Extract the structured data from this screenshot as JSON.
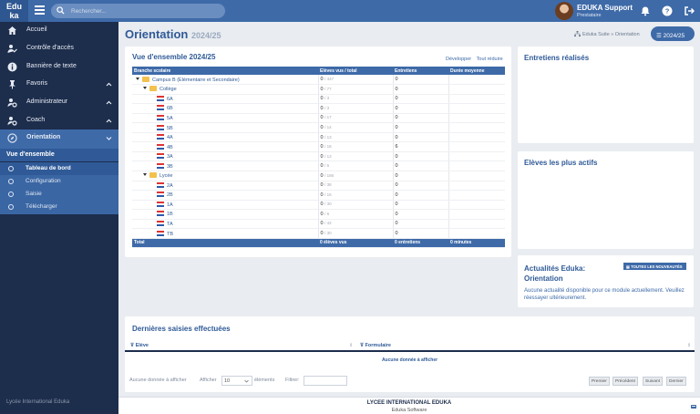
{
  "app": {
    "logo_line1": "Edu",
    "logo_line2": "ka"
  },
  "search": {
    "placeholder": "Rechercher..."
  },
  "user": {
    "name": "EDUKA Support",
    "role": "Prestataire"
  },
  "sidebar": {
    "items": [
      {
        "label": "Accueil",
        "icon": "home-icon"
      },
      {
        "label": "Contrôle d'accès",
        "icon": "user-check-icon"
      },
      {
        "label": "Bannière de texte",
        "icon": "info-icon"
      },
      {
        "label": "Favoris",
        "icon": "pin-icon"
      },
      {
        "label": "Administrateur",
        "icon": "user-gear-icon"
      },
      {
        "label": "Coach",
        "icon": "user-gear-icon"
      },
      {
        "label": "Orientation",
        "icon": "compass-icon"
      }
    ],
    "sub_header": "Vue d'ensemble",
    "sub_items": [
      "Tableau de bord",
      "Configuration",
      "Saisie",
      "Télécharger"
    ],
    "footer": "Lycée International Eduka"
  },
  "page": {
    "title": "Orientation",
    "year": "2024/25",
    "breadcrumb": "Eduka Suite » Orientation",
    "year_button": "2024/25"
  },
  "overview": {
    "title": "Vue d'ensemble 2024/25",
    "expand": "Développer",
    "collapse": "Tout réduire",
    "columns": [
      "Branche scolaire",
      "Elèves vus / total",
      "Entretiens",
      "Durée moyenne"
    ],
    "rows": [
      {
        "level": 0,
        "type": "campus",
        "name": "Campus B (Elémentaire et Secondaire)",
        "seen": "0",
        "total": "/ 447",
        "interviews": "0"
      },
      {
        "level": 1,
        "type": "folder",
        "name": "Collège",
        "seen": "0",
        "total": "/ 77",
        "interviews": "0"
      },
      {
        "level": 2,
        "type": "class",
        "name": "6A",
        "seen": "0",
        "total": "/ 3",
        "interviews": "0"
      },
      {
        "level": 2,
        "type": "class",
        "name": "6B",
        "seen": "0",
        "total": "/ 3",
        "interviews": "0"
      },
      {
        "level": 2,
        "type": "class",
        "name": "5A",
        "seen": "0",
        "total": "/ 17",
        "interviews": "0"
      },
      {
        "level": 2,
        "type": "class",
        "name": "5B",
        "seen": "0",
        "total": "/ 14",
        "interviews": "0"
      },
      {
        "level": 2,
        "type": "class",
        "name": "4A",
        "seen": "0",
        "total": "/ 13",
        "interviews": "0"
      },
      {
        "level": 2,
        "type": "class",
        "name": "4B",
        "seen": "0",
        "total": "/ 18",
        "interviews": "6"
      },
      {
        "level": 2,
        "type": "class",
        "name": "3A",
        "seen": "0",
        "total": "/ 13",
        "interviews": "0"
      },
      {
        "level": 2,
        "type": "class",
        "name": "3B",
        "seen": "0",
        "total": "/ 6",
        "interviews": "0"
      },
      {
        "level": 1,
        "type": "folder",
        "name": "Lycée",
        "seen": "0",
        "total": "/ 186",
        "interviews": "0"
      },
      {
        "level": 2,
        "type": "class",
        "name": "2A",
        "seen": "0",
        "total": "/ 38",
        "interviews": "0"
      },
      {
        "level": 2,
        "type": "class",
        "name": "2B",
        "seen": "0",
        "total": "/ 15",
        "interviews": "0"
      },
      {
        "level": 2,
        "type": "class",
        "name": "1A",
        "seen": "0",
        "total": "/ 30",
        "interviews": "0"
      },
      {
        "level": 2,
        "type": "class",
        "name": "1B",
        "seen": "0",
        "total": "/ 6",
        "interviews": "0"
      },
      {
        "level": 2,
        "type": "class",
        "name": "TA",
        "seen": "0",
        "total": "/ 42",
        "interviews": "0"
      },
      {
        "level": 2,
        "type": "class",
        "name": "TB",
        "seen": "0",
        "total": "/ 30",
        "interviews": "0"
      }
    ],
    "total": {
      "label": "Total",
      "seen": "0 élèves vus",
      "interviews": "0 entretiens",
      "duration": "0 minutes"
    }
  },
  "interviews_card": {
    "title": "Entretiens réalisés"
  },
  "active_card": {
    "title": "Elèves les plus actifs"
  },
  "news_card": {
    "title_line1": "Actualités Eduka:",
    "title_line2": "Orientation",
    "button": "TOUTES LES NOUVEAUTÉS",
    "text": "Aucune actualité disponible pour ce module actuellement. Veuillez réessayer ultérieurement."
  },
  "last_entries": {
    "title": "Dernières saisies effectuées",
    "columns": [
      "Elève",
      "Formulaire"
    ],
    "empty": "Aucune donnée à afficher",
    "info": "Aucune donnée à afficher",
    "show_label": "Afficher",
    "page_size": "10",
    "entries_label": "éléments",
    "filter_label": "Filtrer:",
    "pager": [
      "Premier",
      "Précédent",
      "Suivant",
      "Dernier"
    ]
  },
  "footer": {
    "line1": "LYCEE INTERNATIONAL EDUKA",
    "line2": "Eduka Software"
  },
  "colors": {
    "primary": "#3e6aa8",
    "sidebar": "#1d2d4c",
    "background": "#e9ecf0"
  }
}
